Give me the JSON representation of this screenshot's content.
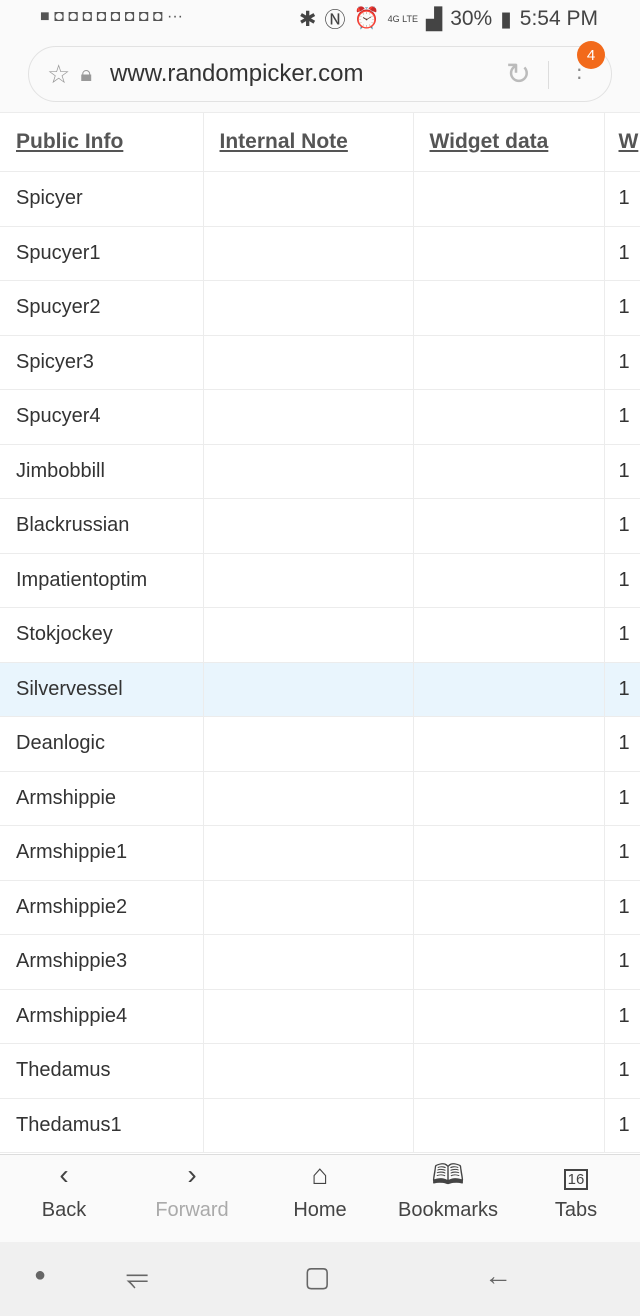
{
  "status": {
    "time": "5:54 PM",
    "battery": "30%",
    "network": "4G LTE"
  },
  "browser": {
    "url": "www.randompicker.com",
    "menu_badge": "4"
  },
  "table": {
    "headers": [
      "Public Info",
      "Internal Note",
      "Widget data",
      "W"
    ],
    "rows": [
      "Spicyer",
      "Spucyer1",
      "Spucyer2",
      "Spicyer3",
      "Spucyer4",
      "Jimbobbill",
      "Blackrussian",
      "Impatientoptim",
      "Stokjockey",
      "Silvervessel",
      "Deanlogic",
      "Armshippie",
      "Armshippie1",
      "Armshippie2",
      "Armshippie3",
      "Armshippie4",
      "Thedamus",
      "Thedamus1"
    ],
    "fourth_value": "1",
    "highlighted_row": "Silvervessel"
  },
  "bottom_nav": {
    "back": "Back",
    "forward": "Forward",
    "home": "Home",
    "bookmarks": "Bookmarks",
    "tabs": "Tabs",
    "tab_count": "16"
  }
}
